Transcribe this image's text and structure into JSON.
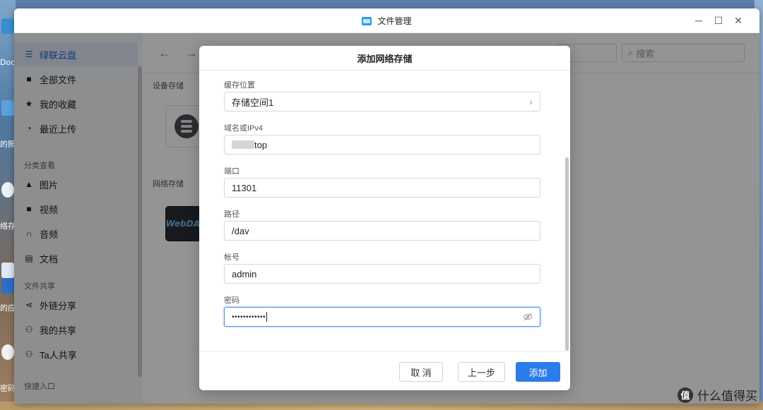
{
  "window": {
    "title": "文件管理"
  },
  "sidebar": {
    "items": [
      {
        "label": "绿联云盘",
        "icon": "list-icon",
        "active": true
      },
      {
        "label": "全部文件",
        "icon": "folder-icon"
      },
      {
        "label": "我的收藏",
        "icon": "star-icon"
      },
      {
        "label": "最近上传",
        "icon": "clock-icon"
      }
    ],
    "section_category": "分类查看",
    "category_items": [
      {
        "label": "图片",
        "icon": "image-icon"
      },
      {
        "label": "视频",
        "icon": "video-icon"
      },
      {
        "label": "音频",
        "icon": "headphones-icon"
      },
      {
        "label": "文档",
        "icon": "document-icon"
      }
    ],
    "section_share": "文件共享",
    "share_items": [
      {
        "label": "外链分享",
        "icon": "share-icon"
      },
      {
        "label": "我的共享",
        "icon": "users-icon"
      },
      {
        "label": "Ta人共享",
        "icon": "users-icon"
      }
    ],
    "section_quick": "快捷入口"
  },
  "main": {
    "search_placeholder": "搜索",
    "device_storage_label": "设备存储",
    "network_storage_label": "网络存储",
    "webdav_label": "WebDAV"
  },
  "dialog": {
    "title": "添加网络存储",
    "cache_label": "缓存位置",
    "cache_value": "存储空间1",
    "host_label": "域名或IPv4",
    "host_value_suffix": "top",
    "port_label": "端口",
    "port_value": "11301",
    "path_label": "路径",
    "path_value": "/dav",
    "account_label": "帐号",
    "account_value": "admin",
    "password_label": "密码",
    "password_value": "••••••••••••",
    "cancel_label": "取 消",
    "prev_label": "上一步",
    "add_label": "添加"
  },
  "desktop": {
    "fragments": [
      "Doc",
      "的照",
      "络存",
      "的应",
      "密码"
    ]
  },
  "watermark": {
    "icon_text": "值",
    "text": "什么值得买"
  },
  "colors": {
    "accent": "#2b7ce9",
    "sidebar_active_bg": "#dfe6f3",
    "sidebar_active_text": "#1e63d6"
  }
}
